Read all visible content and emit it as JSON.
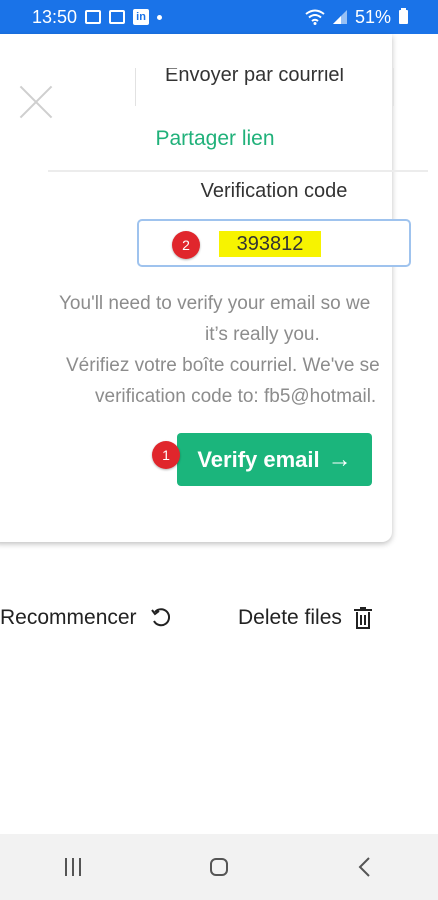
{
  "status_bar": {
    "time": "13:50",
    "battery": "51%",
    "icons": [
      "video-icon",
      "gallery-icon",
      "linkedin-icon",
      "dot-icon",
      "wifi-icon",
      "signal-icon",
      "battery-icon"
    ],
    "linkedin_glyph": "in",
    "background": "#1a73e8"
  },
  "tabs": {
    "email": "Envoyer par courriel",
    "share": "Partager lien"
  },
  "verification": {
    "label": "Verification code",
    "code": "393812",
    "badge_code": "2"
  },
  "info_lines": [
    "You'll need to verify your email so we",
    "it’s really you.",
    "Vérifiez votre boîte courriel. We've se",
    "verification code to: fb5@hotmail."
  ],
  "verify_button": {
    "label": "Verify email",
    "arrow": "→",
    "badge": "1",
    "color": "#1bb57c"
  },
  "actions": {
    "restart": "Recommencer",
    "delete": "Delete files"
  },
  "accent_color": "#20b17a"
}
